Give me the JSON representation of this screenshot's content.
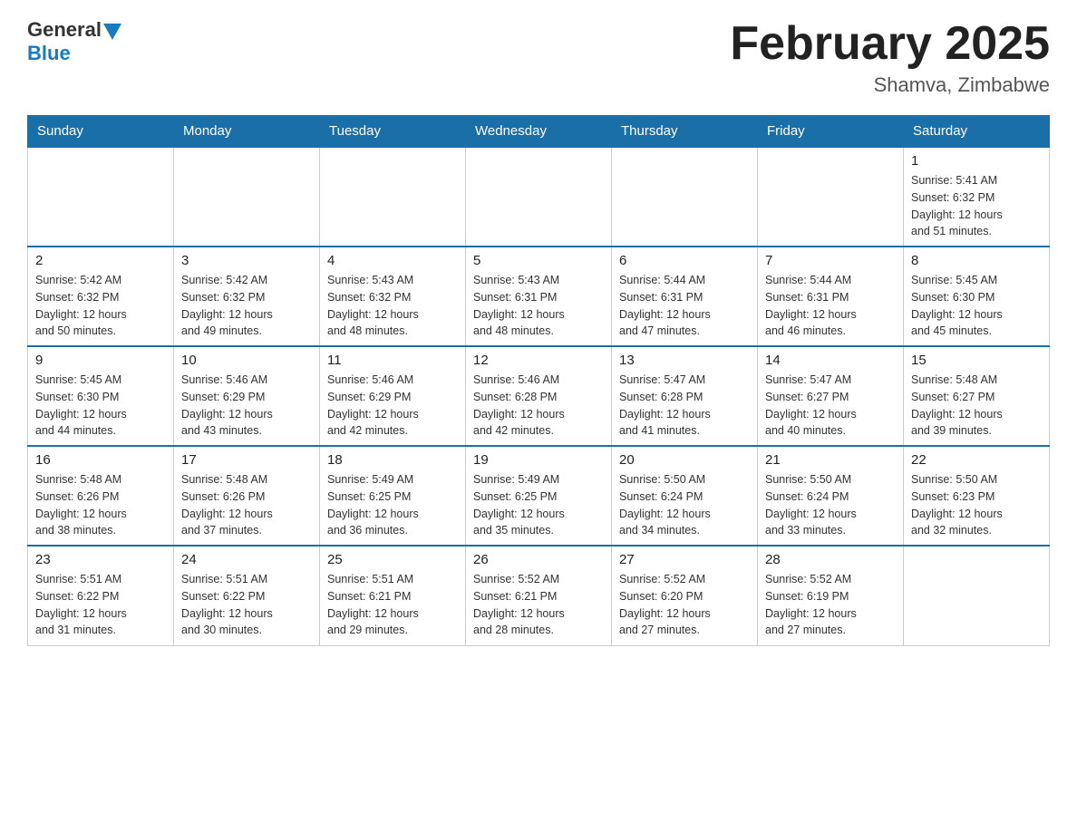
{
  "header": {
    "logo_general": "General",
    "logo_blue": "Blue",
    "month_title": "February 2025",
    "location": "Shamva, Zimbabwe"
  },
  "days_of_week": [
    "Sunday",
    "Monday",
    "Tuesday",
    "Wednesday",
    "Thursday",
    "Friday",
    "Saturday"
  ],
  "weeks": [
    [
      {
        "day": "",
        "info": ""
      },
      {
        "day": "",
        "info": ""
      },
      {
        "day": "",
        "info": ""
      },
      {
        "day": "",
        "info": ""
      },
      {
        "day": "",
        "info": ""
      },
      {
        "day": "",
        "info": ""
      },
      {
        "day": "1",
        "info": "Sunrise: 5:41 AM\nSunset: 6:32 PM\nDaylight: 12 hours\nand 51 minutes."
      }
    ],
    [
      {
        "day": "2",
        "info": "Sunrise: 5:42 AM\nSunset: 6:32 PM\nDaylight: 12 hours\nand 50 minutes."
      },
      {
        "day": "3",
        "info": "Sunrise: 5:42 AM\nSunset: 6:32 PM\nDaylight: 12 hours\nand 49 minutes."
      },
      {
        "day": "4",
        "info": "Sunrise: 5:43 AM\nSunset: 6:32 PM\nDaylight: 12 hours\nand 48 minutes."
      },
      {
        "day": "5",
        "info": "Sunrise: 5:43 AM\nSunset: 6:31 PM\nDaylight: 12 hours\nand 48 minutes."
      },
      {
        "day": "6",
        "info": "Sunrise: 5:44 AM\nSunset: 6:31 PM\nDaylight: 12 hours\nand 47 minutes."
      },
      {
        "day": "7",
        "info": "Sunrise: 5:44 AM\nSunset: 6:31 PM\nDaylight: 12 hours\nand 46 minutes."
      },
      {
        "day": "8",
        "info": "Sunrise: 5:45 AM\nSunset: 6:30 PM\nDaylight: 12 hours\nand 45 minutes."
      }
    ],
    [
      {
        "day": "9",
        "info": "Sunrise: 5:45 AM\nSunset: 6:30 PM\nDaylight: 12 hours\nand 44 minutes."
      },
      {
        "day": "10",
        "info": "Sunrise: 5:46 AM\nSunset: 6:29 PM\nDaylight: 12 hours\nand 43 minutes."
      },
      {
        "day": "11",
        "info": "Sunrise: 5:46 AM\nSunset: 6:29 PM\nDaylight: 12 hours\nand 42 minutes."
      },
      {
        "day": "12",
        "info": "Sunrise: 5:46 AM\nSunset: 6:28 PM\nDaylight: 12 hours\nand 42 minutes."
      },
      {
        "day": "13",
        "info": "Sunrise: 5:47 AM\nSunset: 6:28 PM\nDaylight: 12 hours\nand 41 minutes."
      },
      {
        "day": "14",
        "info": "Sunrise: 5:47 AM\nSunset: 6:27 PM\nDaylight: 12 hours\nand 40 minutes."
      },
      {
        "day": "15",
        "info": "Sunrise: 5:48 AM\nSunset: 6:27 PM\nDaylight: 12 hours\nand 39 minutes."
      }
    ],
    [
      {
        "day": "16",
        "info": "Sunrise: 5:48 AM\nSunset: 6:26 PM\nDaylight: 12 hours\nand 38 minutes."
      },
      {
        "day": "17",
        "info": "Sunrise: 5:48 AM\nSunset: 6:26 PM\nDaylight: 12 hours\nand 37 minutes."
      },
      {
        "day": "18",
        "info": "Sunrise: 5:49 AM\nSunset: 6:25 PM\nDaylight: 12 hours\nand 36 minutes."
      },
      {
        "day": "19",
        "info": "Sunrise: 5:49 AM\nSunset: 6:25 PM\nDaylight: 12 hours\nand 35 minutes."
      },
      {
        "day": "20",
        "info": "Sunrise: 5:50 AM\nSunset: 6:24 PM\nDaylight: 12 hours\nand 34 minutes."
      },
      {
        "day": "21",
        "info": "Sunrise: 5:50 AM\nSunset: 6:24 PM\nDaylight: 12 hours\nand 33 minutes."
      },
      {
        "day": "22",
        "info": "Sunrise: 5:50 AM\nSunset: 6:23 PM\nDaylight: 12 hours\nand 32 minutes."
      }
    ],
    [
      {
        "day": "23",
        "info": "Sunrise: 5:51 AM\nSunset: 6:22 PM\nDaylight: 12 hours\nand 31 minutes."
      },
      {
        "day": "24",
        "info": "Sunrise: 5:51 AM\nSunset: 6:22 PM\nDaylight: 12 hours\nand 30 minutes."
      },
      {
        "day": "25",
        "info": "Sunrise: 5:51 AM\nSunset: 6:21 PM\nDaylight: 12 hours\nand 29 minutes."
      },
      {
        "day": "26",
        "info": "Sunrise: 5:52 AM\nSunset: 6:21 PM\nDaylight: 12 hours\nand 28 minutes."
      },
      {
        "day": "27",
        "info": "Sunrise: 5:52 AM\nSunset: 6:20 PM\nDaylight: 12 hours\nand 27 minutes."
      },
      {
        "day": "28",
        "info": "Sunrise: 5:52 AM\nSunset: 6:19 PM\nDaylight: 12 hours\nand 27 minutes."
      },
      {
        "day": "",
        "info": ""
      }
    ]
  ]
}
